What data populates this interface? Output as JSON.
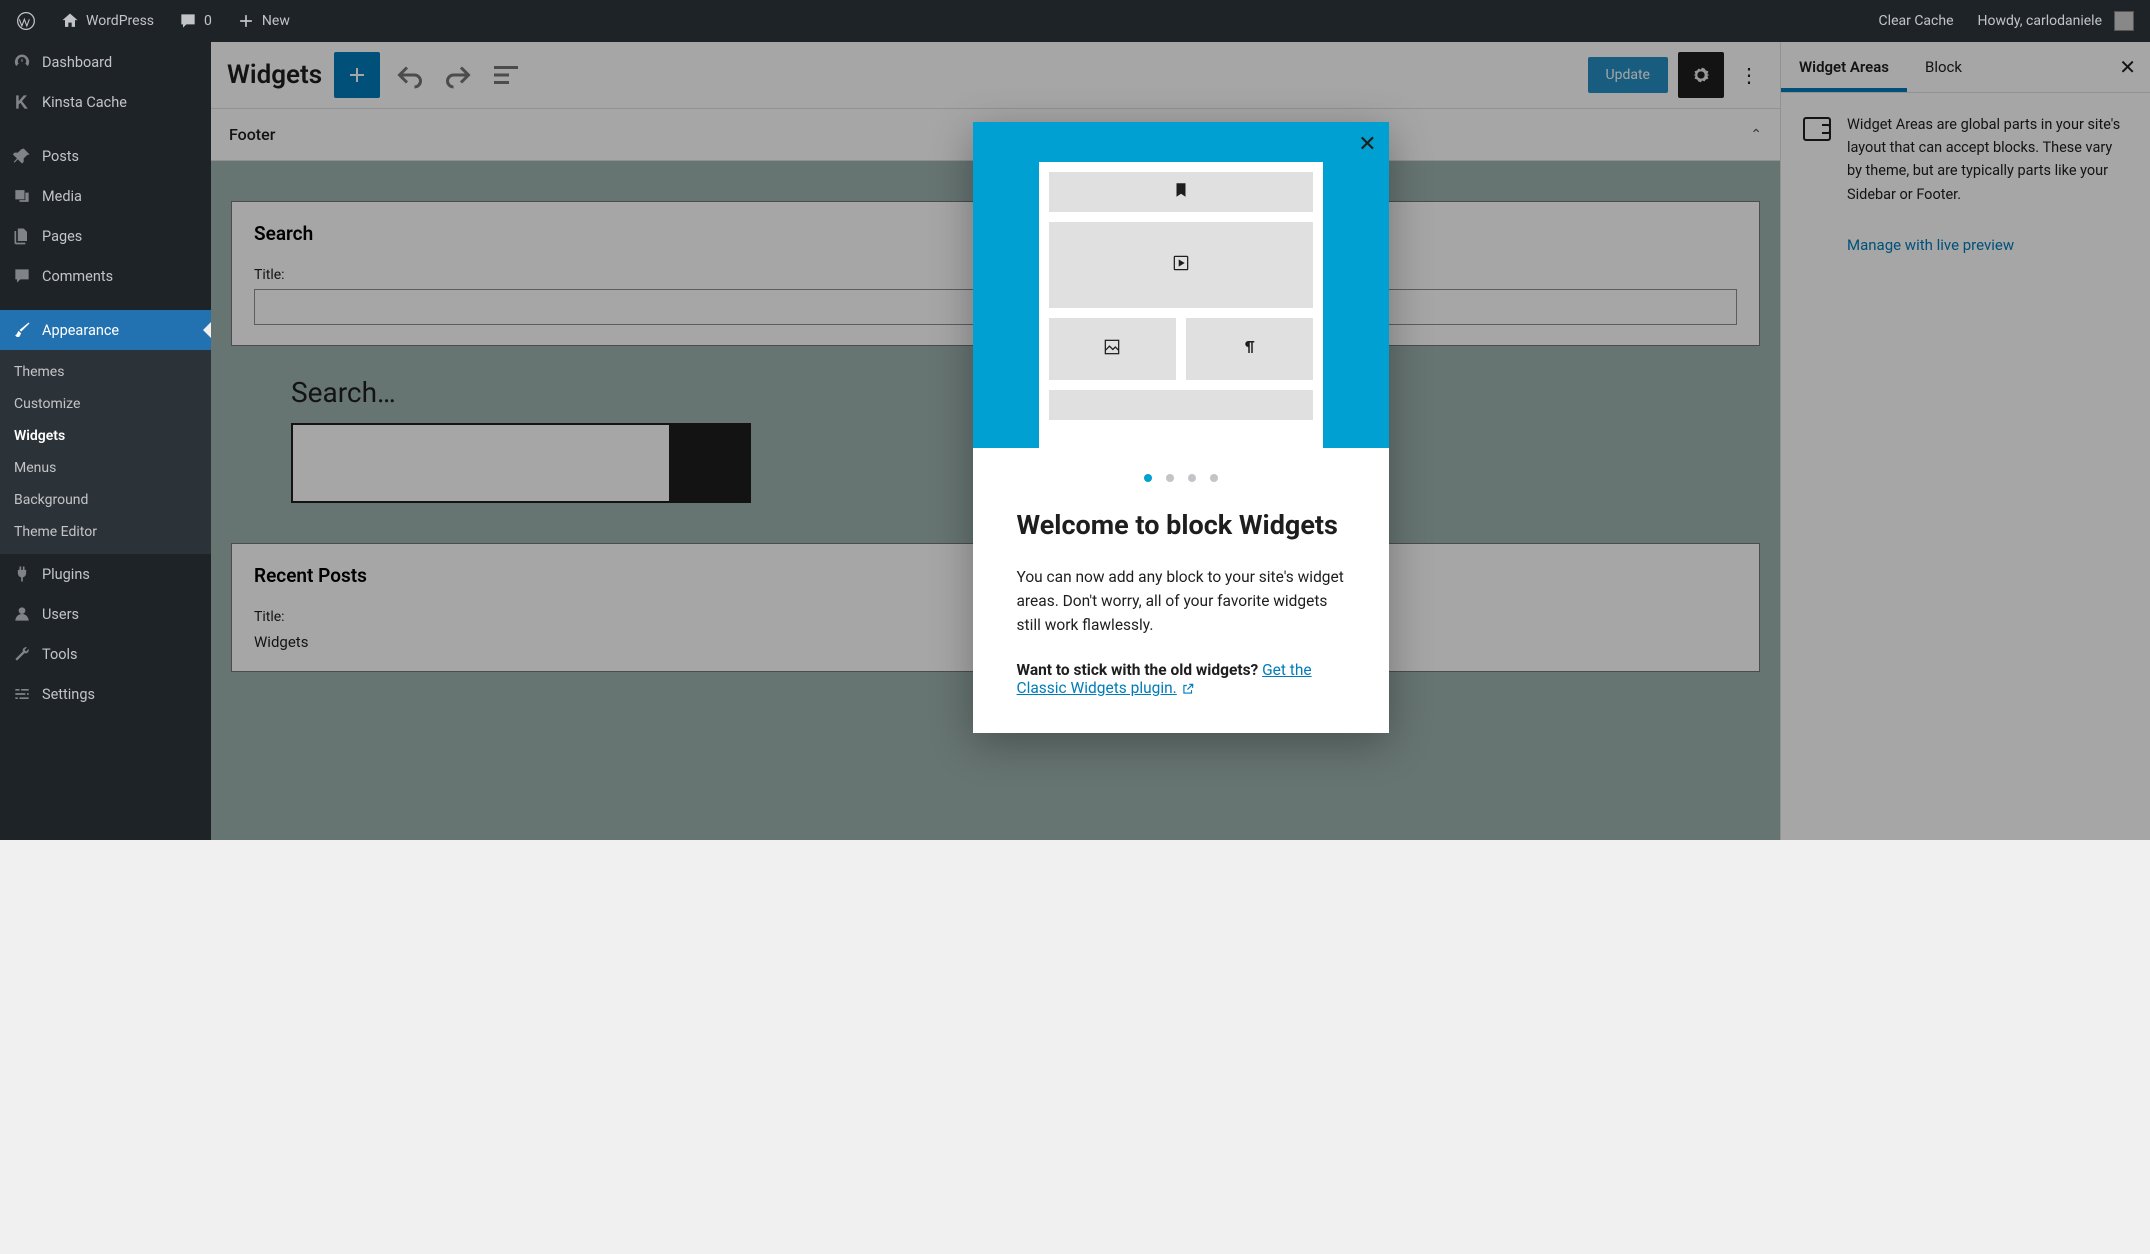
{
  "toolbar": {
    "wordpress": "WordPress",
    "comments": "0",
    "new": "New",
    "clear_cache": "Clear Cache",
    "howdy": "Howdy, carlodaniele"
  },
  "sidebar": {
    "items": [
      {
        "label": "Dashboard",
        "icon": "dashboard"
      },
      {
        "label": "Kinsta Cache",
        "icon": "kinsta"
      },
      {
        "label": "Posts",
        "icon": "pin"
      },
      {
        "label": "Media",
        "icon": "media"
      },
      {
        "label": "Pages",
        "icon": "pages"
      },
      {
        "label": "Comments",
        "icon": "comment"
      },
      {
        "label": "Appearance",
        "icon": "brush",
        "current": true
      },
      {
        "label": "Plugins",
        "icon": "plug"
      },
      {
        "label": "Users",
        "icon": "user"
      },
      {
        "label": "Tools",
        "icon": "wrench"
      },
      {
        "label": "Settings",
        "icon": "sliders"
      }
    ],
    "submenu": [
      {
        "label": "Themes"
      },
      {
        "label": "Customize"
      },
      {
        "label": "Widgets",
        "current": true
      },
      {
        "label": "Menus"
      },
      {
        "label": "Background"
      },
      {
        "label": "Theme Editor"
      }
    ]
  },
  "editor": {
    "title": "Widgets",
    "update": "Update",
    "area_title": "Footer",
    "search_widget": {
      "heading": "Search",
      "title_label": "Title:",
      "title_value": ""
    },
    "search_preview_label": "Search…",
    "recent_posts": {
      "heading": "Recent Posts",
      "title_label": "Title:",
      "block_list_label": "Widgets"
    }
  },
  "inspector": {
    "tabs": [
      "Widget Areas",
      "Block"
    ],
    "description": "Widget Areas are global parts in your site's layout that can accept blocks. These vary by theme, but are typically parts like your Sidebar or Footer.",
    "link": "Manage with live preview"
  },
  "modal": {
    "title": "Welcome to block Widgets",
    "body": "You can now add any block to your site's widget areas. Don't worry, all of your favorite widgets still work flawlessly.",
    "cta_lead": "Want to stick with the old widgets? ",
    "cta_link": "Get the Classic Widgets plugin.",
    "dots": 4,
    "active_dot": 0
  }
}
